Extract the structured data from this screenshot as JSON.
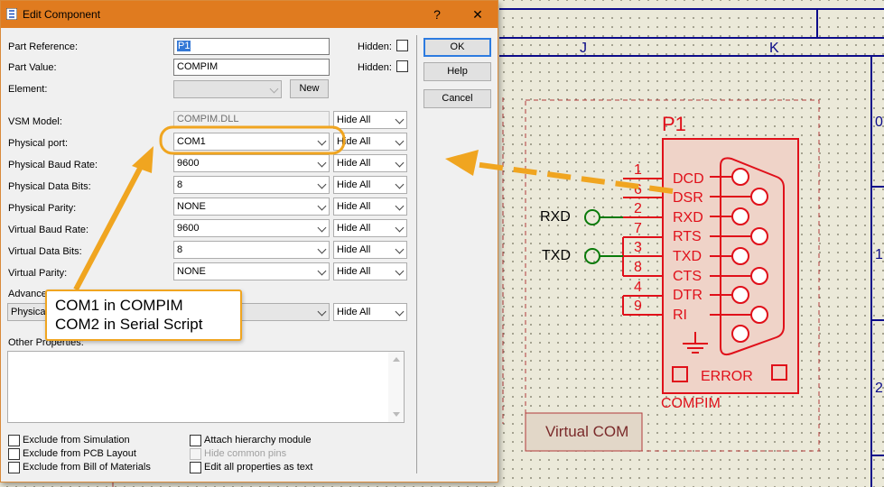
{
  "dialog": {
    "title": "Edit Component",
    "help_btn": "?",
    "close_btn": "✕",
    "ok_label": "OK",
    "help_label": "Help",
    "cancel_label": "Cancel"
  },
  "fields": {
    "part_reference_label": "Part Reference:",
    "part_reference_value": "P1",
    "part_value_label": "Part Value:",
    "part_value_value": "COMPIM",
    "element_label": "Element:",
    "new_label": "New",
    "hidden_label": "Hidden:",
    "vsm_model_label": "VSM Model:",
    "vsm_model_value": "COMPIM.DLL",
    "rows": [
      {
        "label": "Physical port:",
        "value": "COM1"
      },
      {
        "label": "Physical Baud Rate:",
        "value": "9600"
      },
      {
        "label": "Physical Data Bits:",
        "value": "8"
      },
      {
        "label": "Physical Parity:",
        "value": "NONE"
      },
      {
        "label": "Virtual Baud Rate:",
        "value": "9600"
      },
      {
        "label": "Virtual Data Bits:",
        "value": "8"
      },
      {
        "label": "Virtual Parity:",
        "value": "NONE"
      }
    ],
    "hide_all": "Hide All",
    "advanced_label": "Advance",
    "advanced_value": "Physical",
    "other_properties_label": "Other Properties:"
  },
  "checkboxes": {
    "exclude_sim": "Exclude from Simulation",
    "exclude_pcb": "Exclude from PCB Layout",
    "exclude_bom": "Exclude from Bill of Materials",
    "attach_hier": "Attach hierarchy module",
    "hide_pins": "Hide common pins",
    "edit_all": "Edit all properties as text"
  },
  "callout": {
    "line1": "COM1 in COMPIM",
    "line2": "COM2 in Serial Script"
  },
  "schematic": {
    "col_j": "J",
    "col_k": "K",
    "row_0": "0",
    "row_1": "1",
    "row_2": "2",
    "ref": "P1",
    "name": "COMPIM",
    "error": "ERROR",
    "virtual_com": "Virtual COM",
    "rxd_term": "RXD",
    "txd_term": "TXD",
    "pins": [
      {
        "num": "1",
        "name": "DCD"
      },
      {
        "num": "6",
        "name": "DSR"
      },
      {
        "num": "2",
        "name": "RXD"
      },
      {
        "num": "7",
        "name": "RTS"
      },
      {
        "num": "3",
        "name": "TXD"
      },
      {
        "num": "8",
        "name": "CTS"
      },
      {
        "num": "4",
        "name": "DTR"
      },
      {
        "num": "9",
        "name": "RI"
      }
    ],
    "colors": {
      "component": "#e0101a",
      "terminal": "#0a7a0a",
      "frame": "#0c0c8a",
      "accent": "#f0a520"
    }
  }
}
